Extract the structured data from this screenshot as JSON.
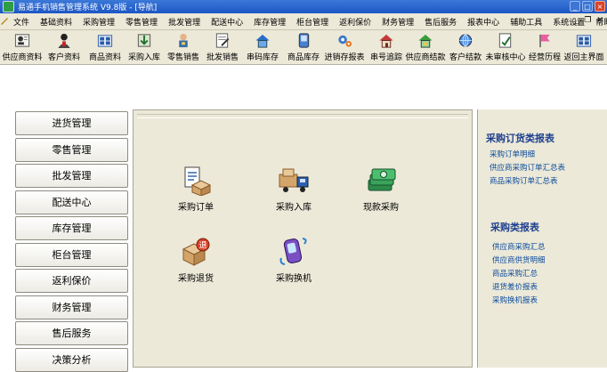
{
  "window": {
    "title": "易通手机销售管理系统 V9.8版 - [导航]"
  },
  "menu": {
    "items": [
      "文件",
      "基础资料",
      "采购管理",
      "零售管理",
      "批发管理",
      "配送中心",
      "库存管理",
      "柜台管理",
      "返利保价",
      "财务管理",
      "售后服务",
      "报表中心",
      "辅助工具",
      "系统设置",
      "帮助"
    ]
  },
  "toolbar": {
    "buttons": [
      "供应商资料",
      "客户资料",
      "商品资料",
      "采购入库",
      "零售销售",
      "批发销售",
      "串码库存",
      "商品库存",
      "进销存报表",
      "串号追踪",
      "供应商结款",
      "客户结款",
      "未审核中心",
      "经营历程",
      "返回主界面"
    ]
  },
  "nav": {
    "buttons": [
      "进货管理",
      "零售管理",
      "批发管理",
      "配送中心",
      "库存管理",
      "柜台管理",
      "返利保价",
      "财务管理",
      "售后服务",
      "决策分析"
    ]
  },
  "functions": [
    "采购订单",
    "采购入库",
    "现款采购",
    "采购退货",
    "采购换机"
  ],
  "reports": {
    "section1_title": "采购订货类报表",
    "section1_links": [
      "采购订单明细",
      "供应商采购订单汇总表",
      "商品采购订单汇总表"
    ],
    "section2_title": "采购类报表",
    "section2_links": [
      "供应商采购汇总",
      "供应商供货明细",
      "商品采购汇总",
      "退货差价报表",
      "采购换机报表"
    ]
  },
  "colors": {
    "titlebar": "#1c56c4",
    "panel": "#ece9d8",
    "link": "#0a4a9b",
    "section_title": "#1d3f8f"
  }
}
